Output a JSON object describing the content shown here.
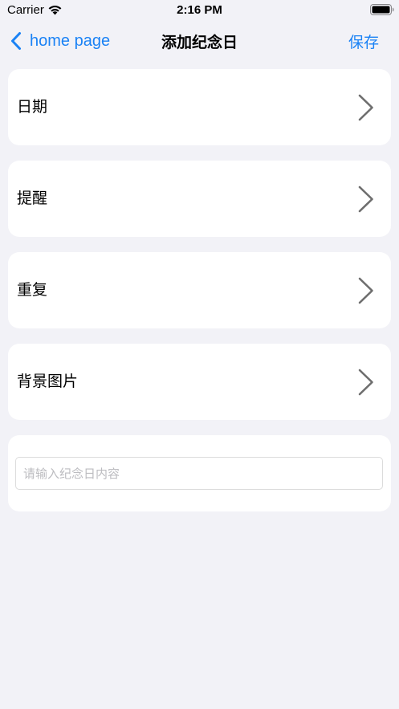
{
  "status_bar": {
    "carrier": "Carrier",
    "time": "2:16 PM",
    "wifi_icon": "wifi-icon",
    "battery_icon": "battery-icon"
  },
  "nav": {
    "back_label": "home page",
    "back_icon": "chevron-left-icon",
    "title": "添加纪念日",
    "save_label": "保存",
    "accent_color": "#1a82f5"
  },
  "rows": [
    {
      "label": "日期",
      "icon": "chevron-right-icon"
    },
    {
      "label": "提醒",
      "icon": "chevron-right-icon"
    },
    {
      "label": "重复",
      "icon": "chevron-right-icon"
    },
    {
      "label": "背景图片",
      "icon": "chevron-right-icon"
    }
  ],
  "content_input": {
    "value": "",
    "placeholder": "请输入纪念日内容"
  },
  "colors": {
    "background": "#f2f2f7",
    "card": "#ffffff",
    "chevron": "#6e6e6e"
  }
}
